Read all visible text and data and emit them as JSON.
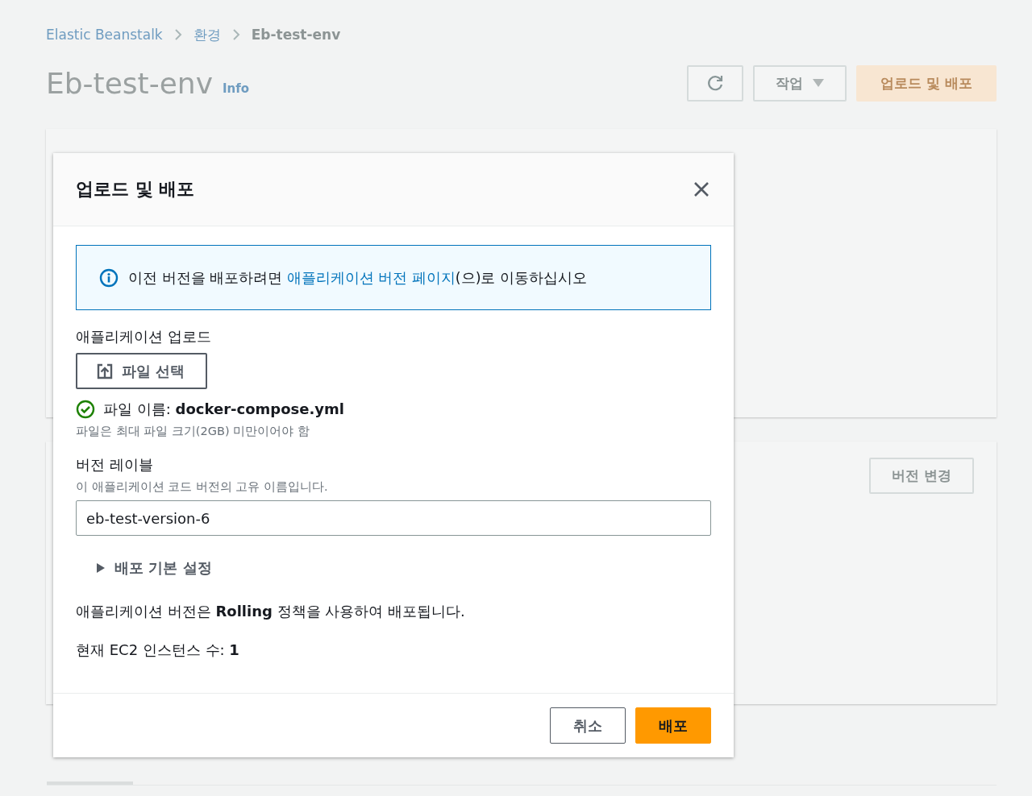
{
  "breadcrumbs": [
    "Elastic Beanstalk",
    "환경",
    "Eb-test-env"
  ],
  "page": {
    "title": "Eb-test-env",
    "info": "Info",
    "actions_button": "작업",
    "primary_button": "업로드 및 배포",
    "change_version_button": "버전 변경"
  },
  "modal": {
    "title": "업로드 및 배포",
    "alert": {
      "before": "이전 버전을 배포하려면 ",
      "link": "애플리케이션 버전 페이지",
      "after": "(으)로 이동하십시오"
    },
    "upload_label": "애플리케이션 업로드",
    "choose_file_button": "파일 선택",
    "file_status": {
      "valid": true,
      "text": "파일 이름: **docker-compose.yml**"
    },
    "file_hint": "파일은 최대 파일 크기(2GB) 미만이어야 함",
    "version_label": "버전 레이블",
    "version_description": "이 애플리케이션 코드 버전의 고유 이름입니다.",
    "version_value": "eb-test-version-6",
    "deployment_settings": {
      "label": "배포 기본 설정",
      "expanded": false
    },
    "policy_text": "애플리케이션 버전은 **Rolling** 정책을 사용하여 배포됩니다.",
    "instances_text": "현재 EC2 인스턴스 수: **1**",
    "cancel_button": "취소",
    "deploy_button": "배포"
  }
}
